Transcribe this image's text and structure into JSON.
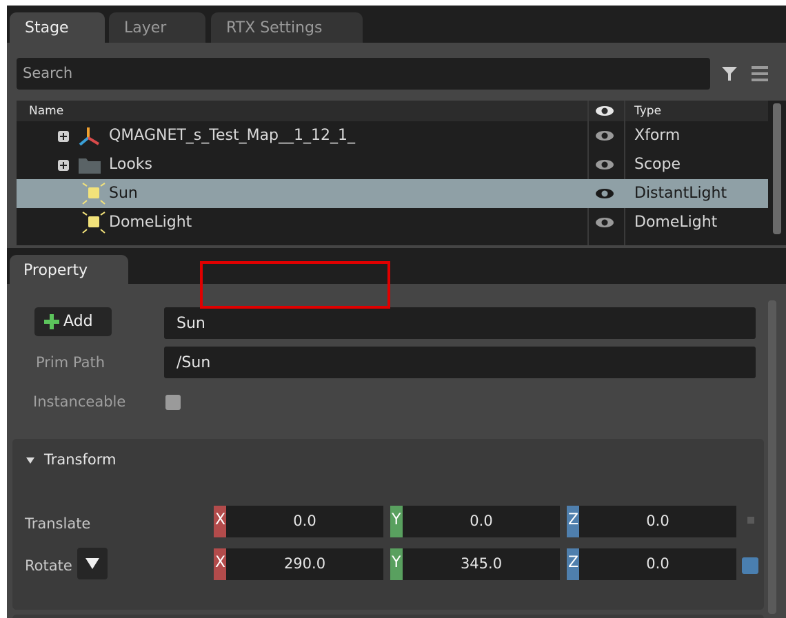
{
  "tabs": [
    {
      "label": "Stage",
      "active": true
    },
    {
      "label": "Layer",
      "active": false
    },
    {
      "label": "RTX Settings",
      "active": false
    }
  ],
  "stage": {
    "search_placeholder": "Search",
    "icons": {
      "filter": "filter-icon",
      "menu": "hamburger-menu-icon"
    },
    "columns": {
      "name": "Name",
      "visibility": "eye-icon",
      "type": "Type"
    },
    "rows": [
      {
        "name": "QMAGNET_s_Test_Map__1_12_1_",
        "type": "Xform",
        "icon": "xform-axes-icon",
        "expandable": true,
        "selected": false
      },
      {
        "name": "Looks",
        "type": "Scope",
        "icon": "folder-icon",
        "expandable": true,
        "selected": false
      },
      {
        "name": "Sun",
        "type": "DistantLight",
        "icon": "light-icon",
        "expandable": false,
        "selected": true
      },
      {
        "name": "DomeLight",
        "type": "DomeLight",
        "icon": "light-icon",
        "expandable": false,
        "selected": false
      }
    ]
  },
  "property": {
    "tab_label": "Property",
    "add_label": "Add",
    "prim_name": "Sun",
    "prim_path_label": "Prim Path",
    "prim_path": "/Sun",
    "instanceable_label": "Instanceable",
    "transform": {
      "header": "Transform",
      "translate": {
        "label": "Translate",
        "x": "0.0",
        "y": "0.0",
        "z": "0.0"
      },
      "rotate": {
        "label": "Rotate",
        "x": "290.0",
        "y": "345.0",
        "z": "0.0"
      },
      "axis_labels": {
        "x": "X",
        "y": "Y",
        "z": "Z"
      }
    }
  },
  "colors": {
    "axis_x": "#b24b4b",
    "axis_y": "#59a05f",
    "axis_z": "#4f7fad",
    "highlight": "#e00000",
    "selected_row": "#8fa0a6"
  }
}
